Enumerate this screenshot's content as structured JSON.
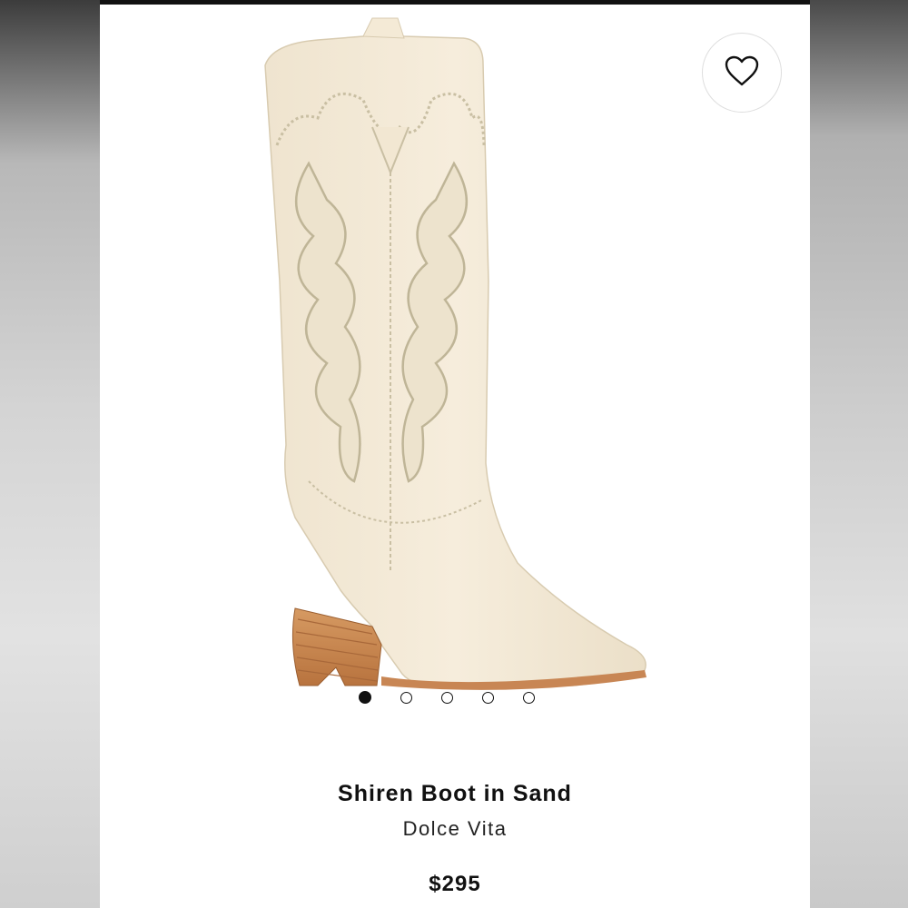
{
  "product": {
    "title": "Shiren Boot in Sand",
    "brand": "Dolce Vita",
    "price": "$295"
  },
  "gallery": {
    "image_count": 5,
    "active_index": 0
  },
  "icons": {
    "favorite": "heart-icon"
  },
  "colors": {
    "boot": "#f3e9d6",
    "stitching": "#c9bfa3",
    "heel": "#c9864f",
    "active_dot": "#111111"
  }
}
